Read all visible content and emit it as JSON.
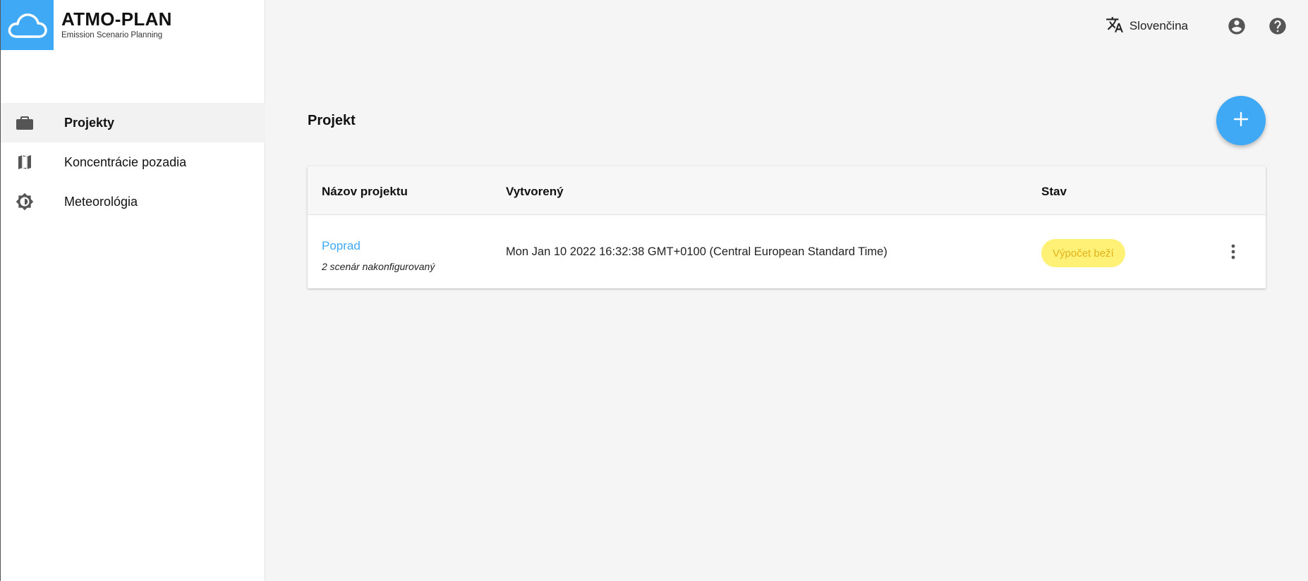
{
  "app": {
    "title": "ATMO-PLAN",
    "subtitle": "Emission Scenario Planning"
  },
  "sidebar": {
    "items": [
      {
        "label": "Projekty",
        "icon": "briefcase-icon",
        "active": true
      },
      {
        "label": "Koncentrácie pozadia",
        "icon": "map-icon",
        "active": false
      },
      {
        "label": "Meteorológia",
        "icon": "brightness-icon",
        "active": false
      }
    ]
  },
  "topbar": {
    "language": "Slovenčina",
    "icons": [
      "translate-icon",
      "account-icon",
      "help-icon"
    ]
  },
  "main": {
    "title": "Projekt",
    "fab_icon": "plus-icon",
    "table": {
      "headers": [
        "Názov projektu",
        "Vytvorený",
        "Stav"
      ],
      "rows": [
        {
          "name": "Poprad",
          "subtitle": "2 scenár nakonfigurovaný",
          "created": "Mon Jan 10 2022 16:32:38 GMT+0100 (Central European Standard Time)",
          "status": "Výpočet beží"
        }
      ]
    }
  },
  "colors": {
    "accent": "#3fa9f5",
    "status_bg": "#fff176",
    "status_text": "#e3b21a"
  }
}
